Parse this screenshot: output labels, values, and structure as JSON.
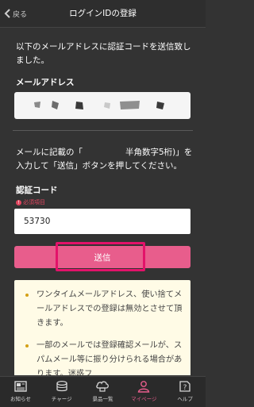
{
  "header": {
    "back_label": "戻る",
    "title": "ログインIDの登録"
  },
  "content": {
    "intro_text": "以下のメールアドレスに認証コードを送信致しました。",
    "email_label": "メールアドレス",
    "instruction_prefix": "メールに記載の「",
    "instruction_suffix": "半角数字5桁)」を入力して「送信」ボタンを押してください。",
    "code_label": "認証コード",
    "required_badge": "必須項目",
    "code_value": "53730",
    "send_label": "送信",
    "notices": [
      "ワンタイムメールアドレス、使い捨てメールアドレスでの登録は無効とさせて頂きます。",
      "一部のメールでは登録確認メールが、スパムメール等に振り分けられる場合があります。迷惑フ"
    ]
  },
  "tabbar": {
    "items": [
      {
        "label": "お知らせ",
        "icon": "news-icon",
        "active": false
      },
      {
        "label": "チャージ",
        "icon": "charge-icon",
        "active": false
      },
      {
        "label": "景品一覧",
        "icon": "prize-icon",
        "active": false
      },
      {
        "label": "マイページ",
        "icon": "mypage-icon",
        "active": true
      },
      {
        "label": "ヘルプ",
        "icon": "help-icon",
        "active": false
      }
    ]
  },
  "colors": {
    "background": "#333333",
    "accent": "#e85d8c",
    "highlight_frame": "#e3126a",
    "notice_bg": "#fffbe6",
    "required": "#e0455f"
  }
}
